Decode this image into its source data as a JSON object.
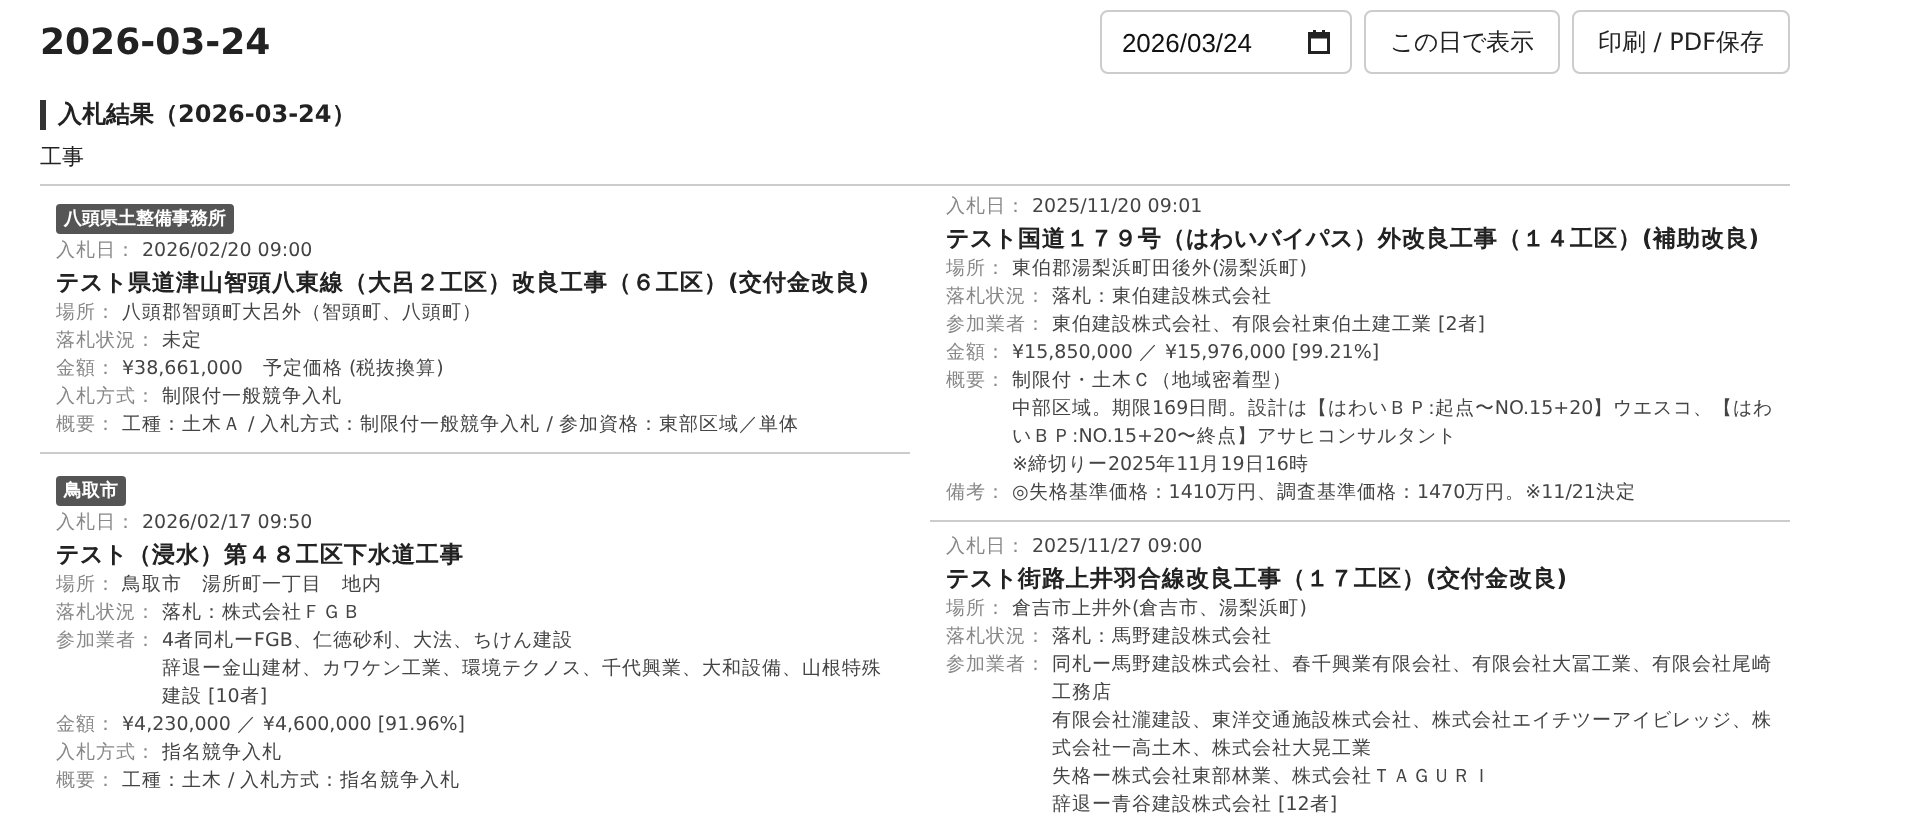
{
  "header": {
    "title": "2026-03-24",
    "date_value": "2026/03/24",
    "buttons": [
      "この日で表示",
      "印刷 / PDF保存"
    ]
  },
  "section": {
    "title": "入札結果（2026-03-24）",
    "category": "工事"
  },
  "columns": [
    {
      "cards": [
        {
          "office": "八頭県土整備事務所",
          "date_label": "入札日：",
          "date": "2026/02/20 09:00",
          "title": "テスト県道津山智頭八東線（大呂２工区）改良工事（６工区）(交付金改良)",
          "fields": [
            {
              "label": "場所：",
              "lines": [
                "八頭郡智頭町大呂外（智頭町、八頭町）"
              ]
            },
            {
              "label": "落札状況：",
              "lines": [
                "未定"
              ]
            },
            {
              "label": "金額：",
              "lines": [
                "¥38,661,000　予定価格 (税抜換算)"
              ]
            },
            {
              "label": "入札方式：",
              "lines": [
                "制限付一般競争入札"
              ]
            },
            {
              "label": "概要：",
              "lines": [
                "工種：土木Ａ / 入札方式：制限付一般競争入札 / 参加資格：東部区域／単体"
              ]
            }
          ]
        },
        {
          "office": "鳥取市",
          "date_label": "入札日：",
          "date": "2026/02/17 09:50",
          "title": "テスト（浸水）第４８工区下水道工事",
          "fields": [
            {
              "label": "場所：",
              "lines": [
                "鳥取市　湯所町一丁目　地内"
              ]
            },
            {
              "label": "落札状況：",
              "lines": [
                "落札：株式会社ＦＧＢ"
              ]
            },
            {
              "label": "参加業者：",
              "lines": [
                "4者同札ーFGB、仁徳砂利、大法、ちけん建設",
                "辞退ー金山建材、カワケン工業、環境テクノス、千代興業、大和設備、山根特殊建設 [10者]"
              ]
            },
            {
              "label": "金額：",
              "lines": [
                "¥4,230,000 ／ ¥4,600,000 [91.96%]"
              ]
            },
            {
              "label": "入札方式：",
              "lines": [
                "指名競争入札"
              ]
            },
            {
              "label": "概要：",
              "lines": [
                "工種：土木 / 入札方式：指名競争入札"
              ]
            }
          ]
        }
      ]
    },
    {
      "cards": [
        {
          "date_label": "入札日：",
          "date": "2025/11/20 09:01",
          "title": "テスト国道１７９号（はわいバイパス）外改良工事（１４工区）(補助改良)",
          "fields": [
            {
              "label": "場所：",
              "lines": [
                "東伯郡湯梨浜町田後外(湯梨浜町)"
              ]
            },
            {
              "label": "落札状況：",
              "lines": [
                "落札：東伯建設株式会社"
              ]
            },
            {
              "label": "参加業者：",
              "lines": [
                "東伯建設株式会社、有限会社東伯土建工業 [2者]"
              ]
            },
            {
              "label": "金額：",
              "lines": [
                "¥15,850,000 ／ ¥15,976,000 [99.21%]"
              ]
            },
            {
              "label": "概要：",
              "lines": [
                "制限付・土木Ｃ（地域密着型）",
                "中部区域。期限169日間。設計は【はわいＢＰ:起点〜NO.15+20】ウエスコ、【はわいＢＰ:NO.15+20〜終点】アサヒコンサルタント",
                "※締切りー2025年11月19日16時"
              ]
            },
            {
              "label": "備考：",
              "lines": [
                "◎失格基準価格：1410万円、調査基準価格：1470万円。※11/21決定"
              ]
            }
          ]
        },
        {
          "date_label": "入札日：",
          "date": "2025/11/27 09:00",
          "title": "テスト街路上井羽合線改良工事（１７工区）(交付金改良)",
          "fields": [
            {
              "label": "場所：",
              "lines": [
                "倉吉市上井外(倉吉市、湯梨浜町)"
              ]
            },
            {
              "label": "落札状況：",
              "lines": [
                "落札：馬野建設株式会社"
              ]
            },
            {
              "label": "参加業者：",
              "lines": [
                "同札ー馬野建設株式会社、春千興業有限会社、有限会社大冨工業、有限会社尾崎工務店",
                "有限会社瀧建設、東洋交通施設株式会社、株式会社エイチツーアイビレッジ、株式会社一高土木、株式会社大晃工業",
                "失格ー株式会社東部林業、株式会社ＴＡＧＵＲＩ",
                "辞退ー青谷建設株式会社 [12者]"
              ]
            }
          ]
        }
      ]
    }
  ]
}
